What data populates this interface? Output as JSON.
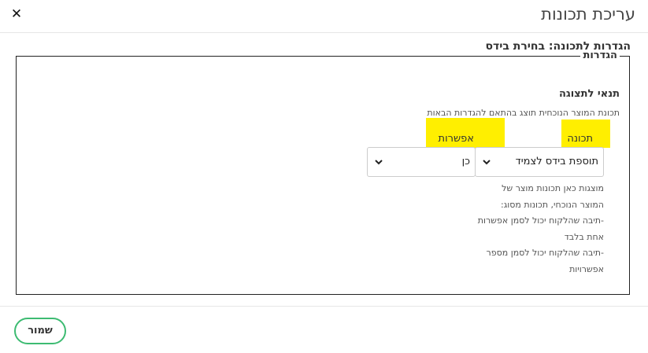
{
  "modal": {
    "title": "עריכת תכונות",
    "close_icon": "close-icon"
  },
  "section": {
    "title": "הגדרות לתכונה: בחירת בידס"
  },
  "settings": {
    "legend": "הגדרות",
    "condition_title": "תנאי לתצוגה",
    "condition_description": "תכונת המוצר הנוכחית תוצג בהתאם להגדרות הבאות",
    "feature_label": "תכונה",
    "option_label": "אפשרות",
    "feature_select_value": "תוספת בידס לצמיד",
    "option_select_value": "כן",
    "help_lines": [
      "מוצגות כאן תכונות מוצר של",
      "המוצר הנוכחי, תכונות מסוג:",
      "-תיבה שהלקוח יכול לסמן אפשרות",
      "אחת בלבד",
      "-תיבה שהלקוח יכול לסמן מספר",
      "אפשרויות"
    ],
    "highlight_color": "#ffef00"
  },
  "footer": {
    "save_label": "שמור",
    "save_border_color": "#3dbb72"
  }
}
